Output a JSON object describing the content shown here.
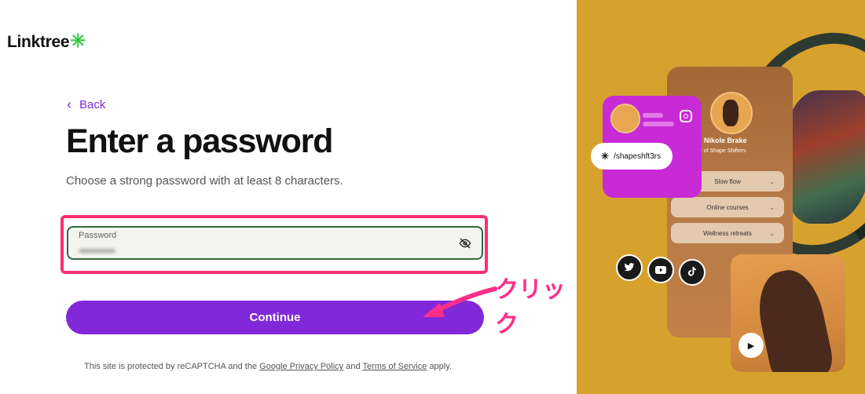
{
  "brand": {
    "name": "Linktree",
    "asterisk": "✳",
    "accent": "#8129d9",
    "green": "#2ecc40"
  },
  "nav": {
    "back_label": "Back",
    "back_icon": "‹"
  },
  "page": {
    "title": "Enter a password",
    "subtitle": "Choose a strong password with at least 8 characters."
  },
  "password_field": {
    "label": "Password",
    "value": "••••••••••"
  },
  "actions": {
    "continue_label": "Continue"
  },
  "annotation": {
    "text": "クリック",
    "color": "#ff2e8a"
  },
  "footer": {
    "prefix": "This site is protected by reCAPTCHA and the",
    "privacy_link": "Google Privacy Policy",
    "and": "and",
    "terms_link": "Terms of Service",
    "suffix": "apply."
  },
  "preview": {
    "profile_name": "Nikole Brake",
    "profile_role": "under of Shape Shifters",
    "links": [
      "Slow flow",
      "Online courses",
      "Wellness retreats"
    ],
    "url": "/shapeshft3rs",
    "socials": [
      "twitter-icon",
      "youtube-icon",
      "tiktok-icon"
    ],
    "background": "#d6a22d"
  }
}
